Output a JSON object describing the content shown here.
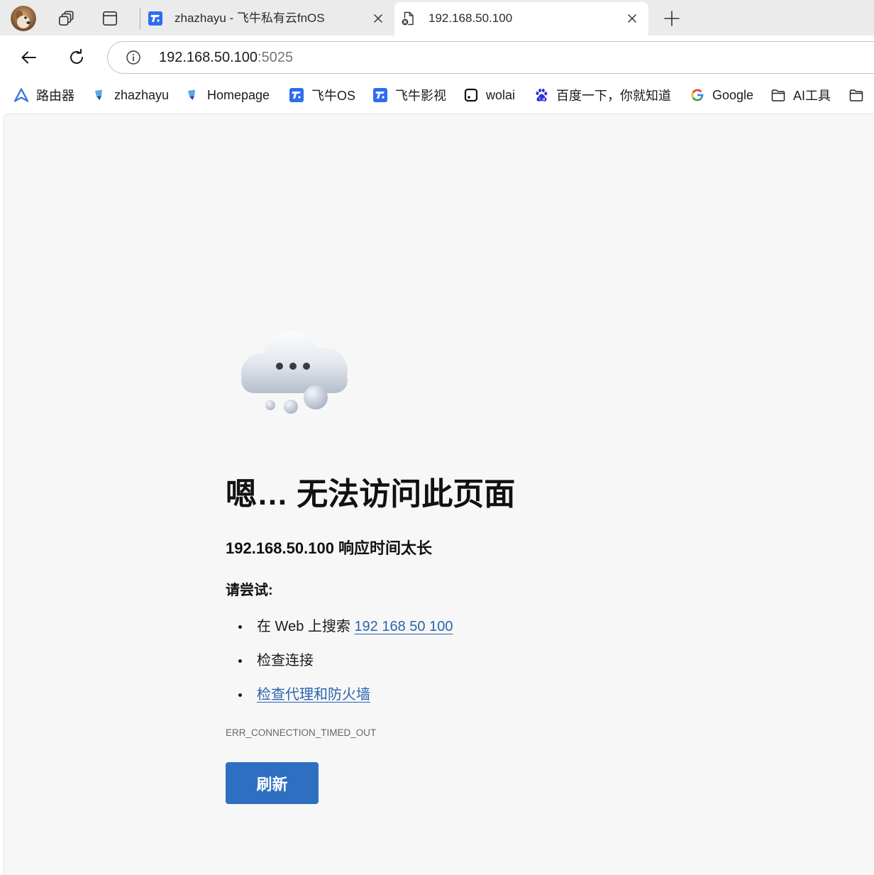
{
  "window": {
    "profile_icon": "profile-avatar-icon",
    "workspaces_icon": "workspaces-icon",
    "tab_actions_icon": "tab-actions-icon",
    "tabs": [
      {
        "title": "zhazhayu - 飞牛私有云fnOS",
        "icon": "fnos-icon",
        "active": false
      },
      {
        "title": "192.168.50.100",
        "icon": "page-error-icon",
        "active": true
      }
    ],
    "new_tab_icon": "plus-icon"
  },
  "navigation": {
    "back_icon": "back-arrow-icon",
    "refresh_icon": "refresh-icon",
    "address": {
      "info_icon": "info-icon",
      "host": "192.168.50.100",
      "port": ":5025"
    }
  },
  "bookmarks": [
    {
      "label": "路由器",
      "icon": "router-icon"
    },
    {
      "label": "zhazhayu",
      "icon": "flag-icon"
    },
    {
      "label": "Homepage",
      "icon": "flag-icon"
    },
    {
      "label": "飞牛OS",
      "icon": "fnos-icon"
    },
    {
      "label": "飞牛影视",
      "icon": "fnos-icon"
    },
    {
      "label": "wolai",
      "icon": "wolai-icon"
    },
    {
      "label": "百度一下，你就知道",
      "icon": "baidu-icon"
    },
    {
      "label": "Google",
      "icon": "google-icon"
    },
    {
      "label": "AI工具",
      "icon": "folder-icon"
    },
    {
      "icon": "folder-icon"
    }
  ],
  "error_page": {
    "illustration": "cloud-icon",
    "title": "嗯… 无法访问此页面",
    "subtitle": "192.168.50.100 响应时间太长",
    "try_label": "请尝试:",
    "suggestions": [
      {
        "text": "在 Web 上搜索",
        "link": "192 168 50 100"
      },
      {
        "text": "检查连接"
      },
      {
        "link": "检查代理和防火墙"
      }
    ],
    "error_code": "ERR_CONNECTION_TIMED_OUT",
    "reload_label": "刷新"
  },
  "colors": {
    "accent": "#2f6fc2",
    "link": "#2b65ad",
    "page_background": "#f7f7f7"
  }
}
